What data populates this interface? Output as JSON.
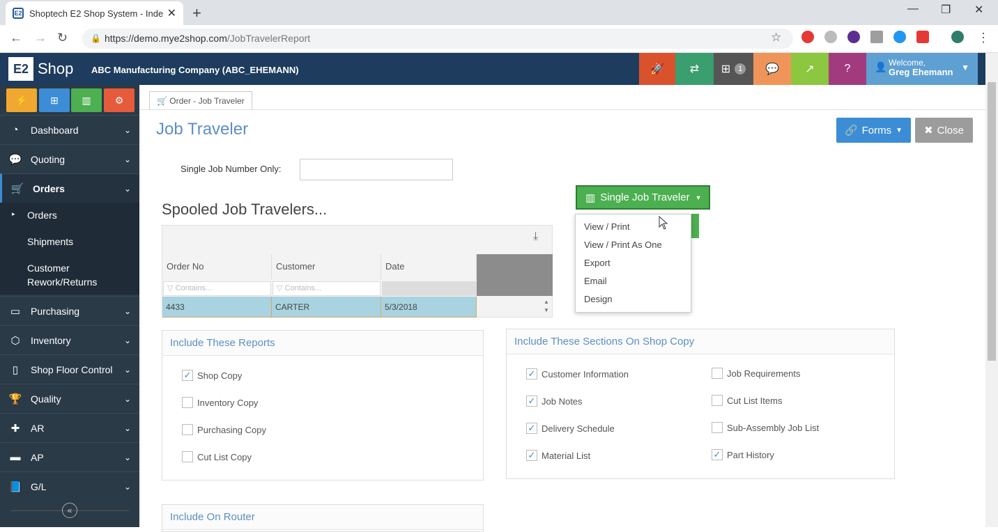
{
  "browser": {
    "tab_title": "Shoptech E2 Shop System - Inde",
    "url_host": "https://demo.mye2shop.com",
    "url_path": "/JobTravelerReport"
  },
  "app": {
    "logo_text": "Shop",
    "company": "ABC Manufacturing Company   (ABC_EHEMANN)",
    "notification_count": "1",
    "welcome_label": "Welcome,",
    "user_name": "Greg Ehemann"
  },
  "colors": {
    "appbar": "#1d3c5e",
    "toolbar": [
      "#d9522c",
      "#3a9e6f",
      "#555555",
      "#f0955a",
      "#8dc63f",
      "#a23b7e"
    ],
    "quick": [
      "#f0a830",
      "#3c8dd6",
      "#4caf50",
      "#e55b3c"
    ]
  },
  "sidebar": {
    "items": [
      {
        "label": "Dashboard",
        "icon": "dashboard-icon"
      },
      {
        "label": "Quoting",
        "icon": "chat-icon"
      },
      {
        "label": "Orders",
        "icon": "cart-icon"
      },
      {
        "label": "Purchasing",
        "icon": "card-icon"
      },
      {
        "label": "Inventory",
        "icon": "cubes-icon"
      },
      {
        "label": "Shop Floor Control",
        "icon": "tablet-icon"
      },
      {
        "label": "Quality",
        "icon": "trophy-icon"
      },
      {
        "label": "AR",
        "icon": "plus-icon"
      },
      {
        "label": "AP",
        "icon": "minus-icon"
      },
      {
        "label": "G/L",
        "icon": "book-icon"
      }
    ],
    "orders_sub": [
      "Orders",
      "Shipments",
      "Customer",
      "Rework/Returns"
    ]
  },
  "page": {
    "breadcrumb": "Order - Job Traveler",
    "title": "Job Traveler",
    "forms_label": "Forms",
    "close_label": "Close",
    "single_job_label": "Single Job Number Only:",
    "single_job_value": "",
    "spooled_title": "Spooled Job Travelers...",
    "single_job_button": "Single Job Traveler"
  },
  "grid": {
    "columns": [
      "Order No",
      "Customer",
      "Date"
    ],
    "filter_placeholder": "Contains...",
    "rows": [
      [
        "4433",
        "CARTER",
        "5/3/2018"
      ]
    ]
  },
  "dropdown": [
    "View / Print",
    "View / Print As One",
    "Export",
    "Email",
    "Design"
  ],
  "reports": {
    "title": "Include These Reports",
    "items": [
      {
        "label": "Shop Copy",
        "checked": true
      },
      {
        "label": "Inventory Copy",
        "checked": false
      },
      {
        "label": "Purchasing Copy",
        "checked": false
      },
      {
        "label": "Cut List Copy",
        "checked": false
      }
    ]
  },
  "sections": {
    "title": "Include These Sections On Shop Copy",
    "left": [
      {
        "label": "Customer Information",
        "checked": true
      },
      {
        "label": "Job Notes",
        "checked": true
      },
      {
        "label": "Delivery Schedule",
        "checked": true
      },
      {
        "label": "Material List",
        "checked": true
      }
    ],
    "right": [
      {
        "label": "Job Requirements",
        "checked": false
      },
      {
        "label": "Cut List Items",
        "checked": false
      },
      {
        "label": "Sub-Assembly Job List",
        "checked": false
      },
      {
        "label": "Part History",
        "checked": true
      }
    ]
  },
  "router": {
    "title": "Include On Router"
  }
}
